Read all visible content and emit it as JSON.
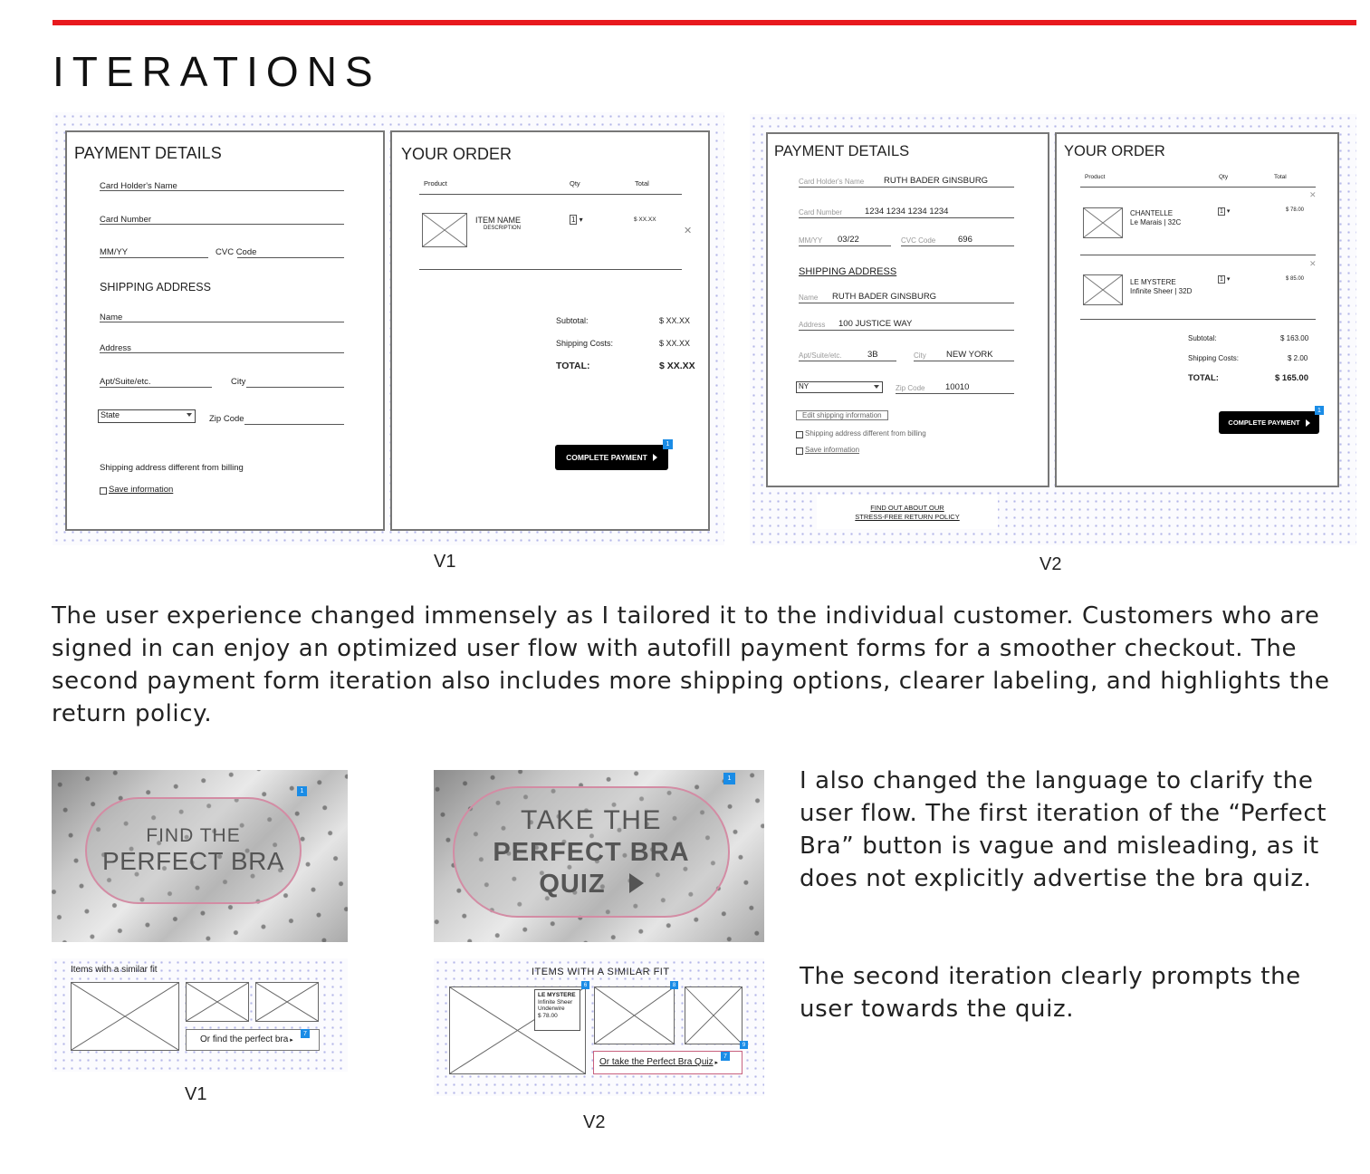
{
  "page": {
    "title": "ITERATIONS",
    "accent_color": "#e8191e",
    "paragraph1": "The user experience changed immensely as I tailored it to the individual customer. Customers who are signed in can enjoy an optimized user flow with autofill payment forms for a smoother checkout. The second payment form iteration also includes more shipping options, clearer labeling, and highlights the return policy.",
    "paragraph2a": "I also changed the language to clarify the user flow. The first iteration of the “Perfect Bra” button is vague and misleading, as it does not explicitly advertise the bra quiz.",
    "paragraph2b": "The second iteration clearly prompts the user towards the quiz."
  },
  "v1_checkout": {
    "caption": "V1",
    "payment_title": "PAYMENT DETAILS",
    "card_holder": "Card Holder's Name",
    "card_number": "Card Number",
    "mmyy": "MM/YY",
    "cvc": "CVC Code",
    "shipping_title": "SHIPPING ADDRESS",
    "name": "Name",
    "address": "Address",
    "apt": "Apt/Suite/etc.",
    "city": "City",
    "state": "State",
    "zip": "Zip Code",
    "diff_billing": "Shipping address different from billing",
    "save_info": "Save information",
    "order_title": "YOUR ORDER",
    "col_product": "Product",
    "col_qty": "Qty",
    "col_total": "Total",
    "item_name": "ITEM NAME",
    "item_desc": "DESCRIPTION",
    "qty": "1",
    "item_price": "$ XX.XX",
    "subtotal_label": "Subtotal:",
    "subtotal": "$ XX.XX",
    "shipping_label": "Shipping Costs:",
    "shipping": "$ XX.XX",
    "total_label": "TOTAL:",
    "total": "$ XX.XX",
    "button": "COMPLETE PAYMENT",
    "badge": "1"
  },
  "v2_checkout": {
    "caption": "V2",
    "payment_title": "PAYMENT DETAILS",
    "card_holder_label": "Card Holder's Name",
    "card_holder": "RUTH BADER GINSBURG",
    "card_number_label": "Card Number",
    "card_number": "1234 1234 1234 1234",
    "mmyy_label": "MM/YY",
    "mmyy": "03/22",
    "cvc_label": "CVC Code",
    "cvc": "696",
    "shipping_title": "SHIPPING ADDRESS",
    "name_label": "Name",
    "name": "RUTH BADER GINSBURG",
    "address_label": "Address",
    "address": "100 JUSTICE WAY",
    "apt_label": "Apt/Suite/etc.",
    "apt": "3B",
    "city_label": "City",
    "city": "NEW YORK",
    "state": "NY",
    "zip_label": "Zip Code",
    "zip": "10010",
    "edit_shipping": "Edit shipping information",
    "diff_billing": "Shipping address different from billing",
    "save_info": "Save information",
    "return_policy_1": "FIND OUT ABOUT OUR",
    "return_policy_2": "STRESS-FREE RETURN POLICY",
    "order_title": "YOUR ORDER",
    "col_product": "Product",
    "col_qty": "Qty",
    "col_total": "Total",
    "item1_name": "CHANTELLE",
    "item1_desc": "Le Marais | 32C",
    "item1_qty": "1",
    "item1_price": "$ 78.00",
    "item2_name": "LE MYSTERE",
    "item2_desc": "Infinite Sheer | 32D",
    "item2_qty": "1",
    "item2_price": "$ 85.00",
    "subtotal_label": "Subtotal:",
    "subtotal": "$ 163.00",
    "shipping_label": "Shipping Costs:",
    "shipping": "$ 2.00",
    "total_label": "TOTAL:",
    "total": "$ 165.00",
    "button": "COMPLETE PAYMENT",
    "badge": "1"
  },
  "v1_bra": {
    "caption": "V1",
    "hero_line1": "FIND THE",
    "hero_line2": "PERFECT BRA",
    "hero_badge": "1",
    "similar_title": "Items with a similar fit",
    "link": "Or find the perfect bra",
    "link_badge": "7"
  },
  "v2_bra": {
    "caption": "V2",
    "hero_line1": "TAKE THE",
    "hero_line2": "PERFECT BRA",
    "hero_line3": "QUIZ",
    "hero_badge": "1",
    "similar_title": "ITEMS WITH A SIMILAR FIT",
    "tooltip_name": "LE MYSTERE",
    "tooltip_line1": "Infinite Sheer",
    "tooltip_line2": "Underwire",
    "tooltip_price": "$ 78.00",
    "badge_a": "6",
    "badge_b": "8",
    "badge_c": "9",
    "link": "Or take the Perfect Bra Quiz",
    "link_badge": "7"
  }
}
